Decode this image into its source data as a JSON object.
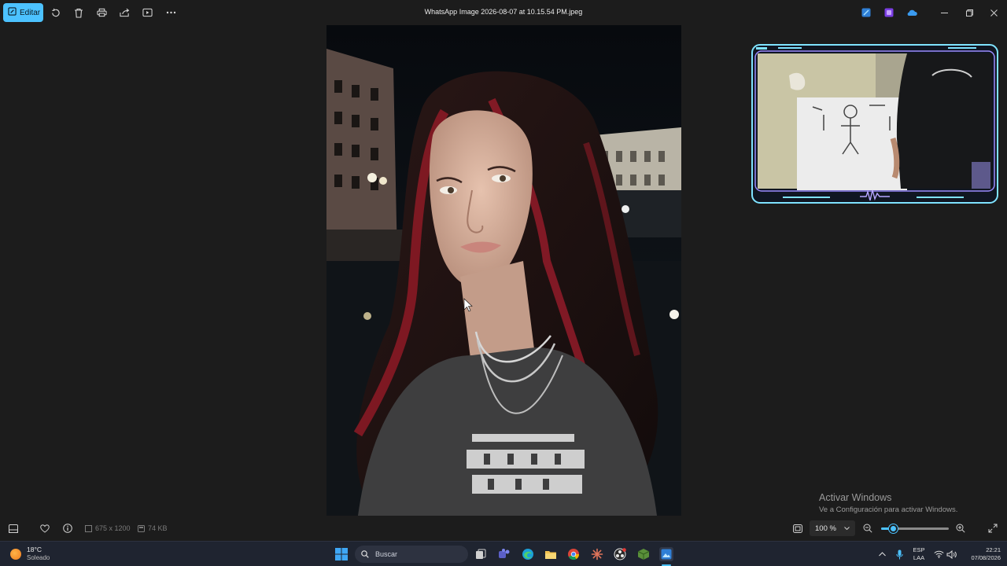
{
  "toolbar": {
    "edit_label": "Editar",
    "icons": [
      "rotate-icon",
      "delete-icon",
      "print-icon",
      "share-icon",
      "slideshow-icon",
      "more-icon"
    ]
  },
  "window": {
    "title": "WhatsApp Image 2026-08-07 at 10.15.54 PM.jpeg",
    "controls": [
      "minimize-icon",
      "maximize-icon",
      "close-icon"
    ]
  },
  "watermark": {
    "line1": "Activar Windows",
    "line2": "Ve a Configuración para activar Windows."
  },
  "status": {
    "dimensions": "675 x 1200",
    "filesize": "74 KB",
    "zoom": "100 %",
    "zoom_level": 0.18
  },
  "taskbar": {
    "temperature": "18°C",
    "condition": "Soleado",
    "search_placeholder": "Buscar",
    "lang_top": "ESP",
    "lang_bottom": "LAA",
    "time": "22:21",
    "date": "07/08/2026"
  },
  "colors": {
    "accent": "#4cc2ff",
    "background": "#1c1c1c",
    "taskbar": "#1f2430"
  }
}
